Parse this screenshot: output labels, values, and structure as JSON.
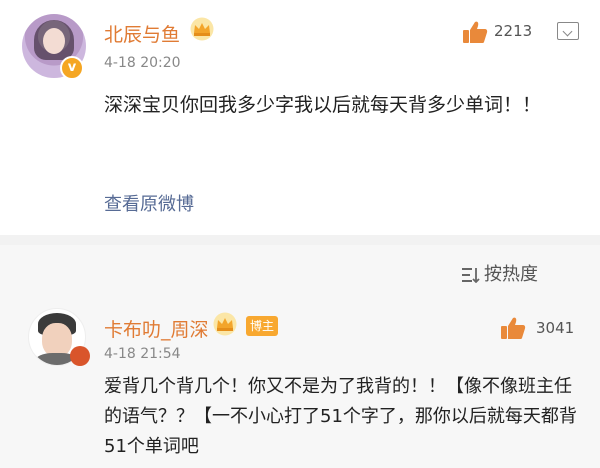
{
  "post": {
    "username": "北辰与鱼",
    "timestamp": "4-18 20:20",
    "likes": "2213",
    "text": "深深宝贝你回我多少字我以后就每天背多少单词！！",
    "view_original": "查看原微博",
    "verified_icon": "v-badge-icon"
  },
  "sort": {
    "label": "按热度",
    "icon": "sort-icon"
  },
  "comment": {
    "username": "卡布叻_周深",
    "tag": "博主",
    "timestamp": "4-18 21:54",
    "likes": "3041",
    "text": "爱背几个背几个！你又不是为了我背的！！【像不像班主任的语气？？【一不小心打了51个字了，那你以后就每天都背51个单词吧"
  },
  "colors": {
    "username": "#e07b34",
    "crown": "#f3a52b",
    "like_icon": "#e9893a",
    "link": "#576b95",
    "tag_bg": "#f8a830",
    "comments_bg": "#f7f7f7"
  }
}
